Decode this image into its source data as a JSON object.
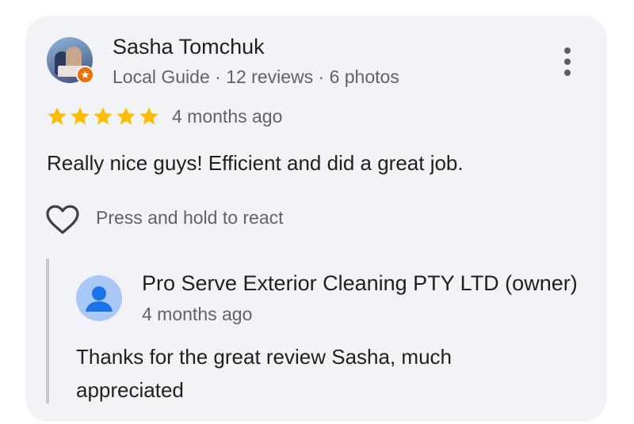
{
  "review": {
    "author_name": "Sasha Tomchuk",
    "author_meta": "Local Guide · 12 reviews · 6 photos",
    "rating": 5,
    "max_rating": 5,
    "time": "4 months ago",
    "text": "Really nice guys! Efficient and did a great job.",
    "react_prompt": "Press and hold to react"
  },
  "owner_reply": {
    "name": "Pro Serve Exterior Cleaning PTY LTD (owner)",
    "time": "4 months ago",
    "text": "Thanks for the great review Sasha, much appreciated"
  },
  "colors": {
    "card_bg": "#f2f3f6",
    "star": "#fbbc04",
    "local_guide_badge": "#e8710a",
    "owner_avatar_bg": "#a9c7f7",
    "owner_avatar_fg": "#1a73e8",
    "secondary_text": "#5f6368"
  },
  "icons": {
    "more": "more-vert-icon",
    "star": "star-icon",
    "react": "heart-outline-icon",
    "badge": "local-guide-icon"
  }
}
